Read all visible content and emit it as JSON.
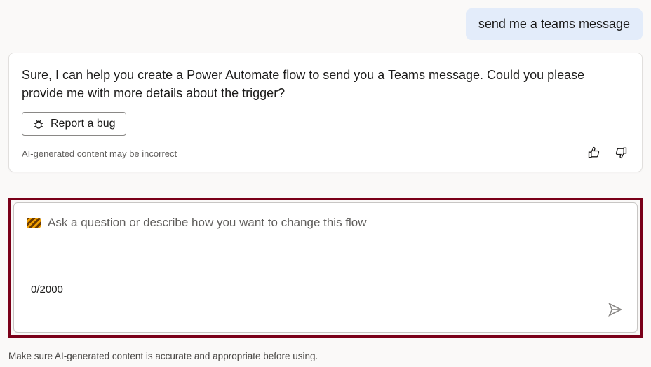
{
  "chat": {
    "user_message": "send me a teams message",
    "assistant_message": "Sure, I can help you create a Power Automate flow to send you a Teams message. Could you please provide me with more details about the trigger?",
    "report_bug_label": "Report a bug",
    "ai_disclaimer_small": "AI-generated content may be incorrect"
  },
  "input": {
    "placeholder": "Ask a question or describe how you want to change this flow",
    "char_counter": "0/2000"
  },
  "footer": {
    "disclaimer": "Make sure AI-generated content is accurate and appropriate before using."
  }
}
